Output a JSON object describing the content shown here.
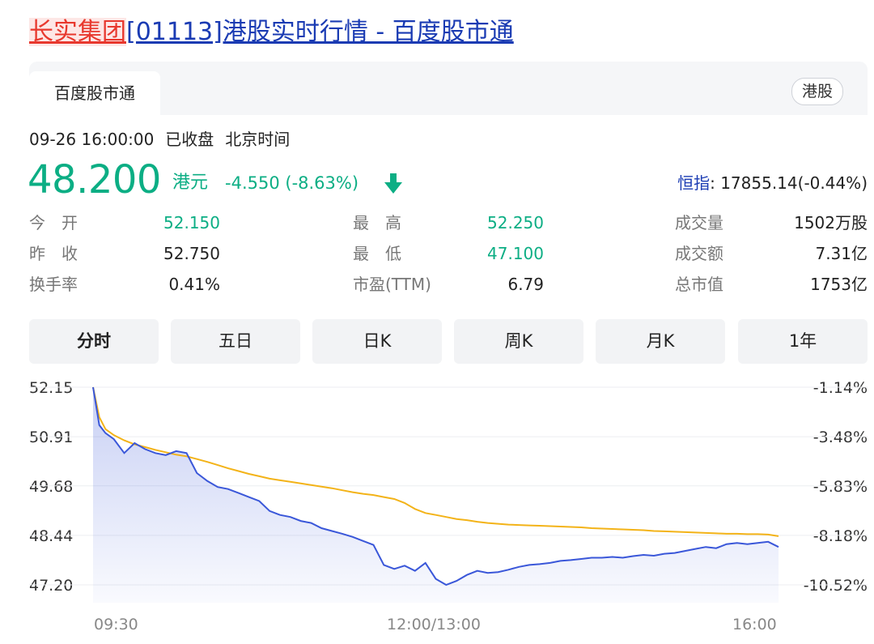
{
  "title": {
    "company": "长实集团",
    "rest": "[01113]港股实时行情 - 百度股市通"
  },
  "source_tab": {
    "label": "百度股市通"
  },
  "market_pill": {
    "label": "港股"
  },
  "status": {
    "time": "09-26 16:00:00",
    "state": "已收盘",
    "tz": "北京时间"
  },
  "quote": {
    "price": "48.200",
    "unit": "港元",
    "change": "-4.550 (-8.63%)"
  },
  "index": {
    "label": "恒指",
    "value": ": 17855.14(-0.44%)"
  },
  "stats": [
    {
      "label": "今　开",
      "value": "52.150"
    },
    {
      "label": "最　高",
      "value": "52.250"
    },
    {
      "label": "成交量",
      "value": "1502万股"
    },
    {
      "label": "昨　收",
      "value": "52.750"
    },
    {
      "label": "最　低",
      "value": "47.100"
    },
    {
      "label": "成交额",
      "value": "7.31亿"
    },
    {
      "label": "换手率",
      "value": "0.41%"
    },
    {
      "label": "市盈(TTM)",
      "value": "6.79"
    },
    {
      "label": "总市值",
      "value": "1753亿"
    }
  ],
  "period_tabs": [
    "分时",
    "五日",
    "日K",
    "周K",
    "月K",
    "1年"
  ],
  "colors": {
    "up_down_green": "#0cae84",
    "price_line": "#3a57d9",
    "avg_line": "#f3b318",
    "link_blue": "#1a3bb3"
  },
  "chart_data": {
    "type": "line",
    "title": "",
    "y_ticks": [
      "52.15",
      "50.91",
      "49.68",
      "48.44",
      "47.20"
    ],
    "y_pct_ticks": [
      "-1.14%",
      "-3.48%",
      "-5.83%",
      "-8.18%",
      "-10.52%"
    ],
    "x_ticks": [
      "09:30",
      "12:00/13:00",
      "16:00"
    ],
    "ylim": [
      47.2,
      52.15
    ],
    "x_domain": [
      0,
      330
    ],
    "series": [
      {
        "role": "price",
        "x": [
          0,
          3,
          6,
          10,
          15,
          20,
          25,
          30,
          35,
          40,
          45,
          50,
          55,
          60,
          65,
          70,
          75,
          80,
          85,
          90,
          95,
          100,
          105,
          110,
          115,
          120,
          125,
          130,
          135,
          140,
          145,
          150,
          155,
          160,
          165,
          170,
          175,
          180,
          185,
          190,
          195,
          200,
          205,
          210,
          215,
          220,
          225,
          230,
          235,
          240,
          245,
          250,
          255,
          260,
          265,
          270,
          275,
          280,
          285,
          290,
          295,
          300,
          305,
          310,
          315,
          320,
          325,
          330
        ],
        "y": [
          52.15,
          51.2,
          51.0,
          50.85,
          50.5,
          50.75,
          50.6,
          50.5,
          50.45,
          50.55,
          50.5,
          50.0,
          49.8,
          49.65,
          49.6,
          49.5,
          49.4,
          49.3,
          49.05,
          48.95,
          48.9,
          48.8,
          48.75,
          48.62,
          48.55,
          48.48,
          48.4,
          48.3,
          48.2,
          47.7,
          47.6,
          47.68,
          47.55,
          47.75,
          47.35,
          47.2,
          47.3,
          47.45,
          47.55,
          47.5,
          47.52,
          47.58,
          47.65,
          47.7,
          47.72,
          47.75,
          47.8,
          47.82,
          47.85,
          47.88,
          47.88,
          47.9,
          47.88,
          47.92,
          47.95,
          47.93,
          47.98,
          48.0,
          48.05,
          48.1,
          48.15,
          48.12,
          48.22,
          48.25,
          48.22,
          48.25,
          48.28,
          48.15
        ]
      },
      {
        "role": "average",
        "x": [
          0,
          3,
          6,
          10,
          15,
          20,
          25,
          30,
          35,
          40,
          45,
          50,
          55,
          60,
          65,
          70,
          75,
          80,
          85,
          90,
          95,
          100,
          105,
          110,
          115,
          120,
          125,
          130,
          135,
          140,
          145,
          150,
          155,
          160,
          165,
          170,
          175,
          180,
          185,
          190,
          195,
          200,
          205,
          210,
          215,
          220,
          225,
          230,
          235,
          240,
          245,
          250,
          255,
          260,
          265,
          270,
          275,
          280,
          285,
          290,
          295,
          300,
          305,
          310,
          315,
          320,
          325,
          330
        ],
        "y": [
          52.15,
          51.4,
          51.1,
          50.95,
          50.82,
          50.72,
          50.65,
          50.58,
          50.52,
          50.46,
          50.42,
          50.35,
          50.28,
          50.2,
          50.12,
          50.05,
          49.98,
          49.92,
          49.86,
          49.82,
          49.78,
          49.74,
          49.7,
          49.66,
          49.62,
          49.57,
          49.52,
          49.48,
          49.45,
          49.4,
          49.35,
          49.25,
          49.1,
          49.0,
          48.95,
          48.9,
          48.85,
          48.82,
          48.78,
          48.75,
          48.73,
          48.71,
          48.7,
          48.69,
          48.68,
          48.67,
          48.66,
          48.65,
          48.64,
          48.62,
          48.61,
          48.6,
          48.59,
          48.58,
          48.57,
          48.55,
          48.54,
          48.53,
          48.52,
          48.51,
          48.5,
          48.49,
          48.48,
          48.48,
          48.47,
          48.47,
          48.46,
          48.42
        ]
      }
    ]
  }
}
